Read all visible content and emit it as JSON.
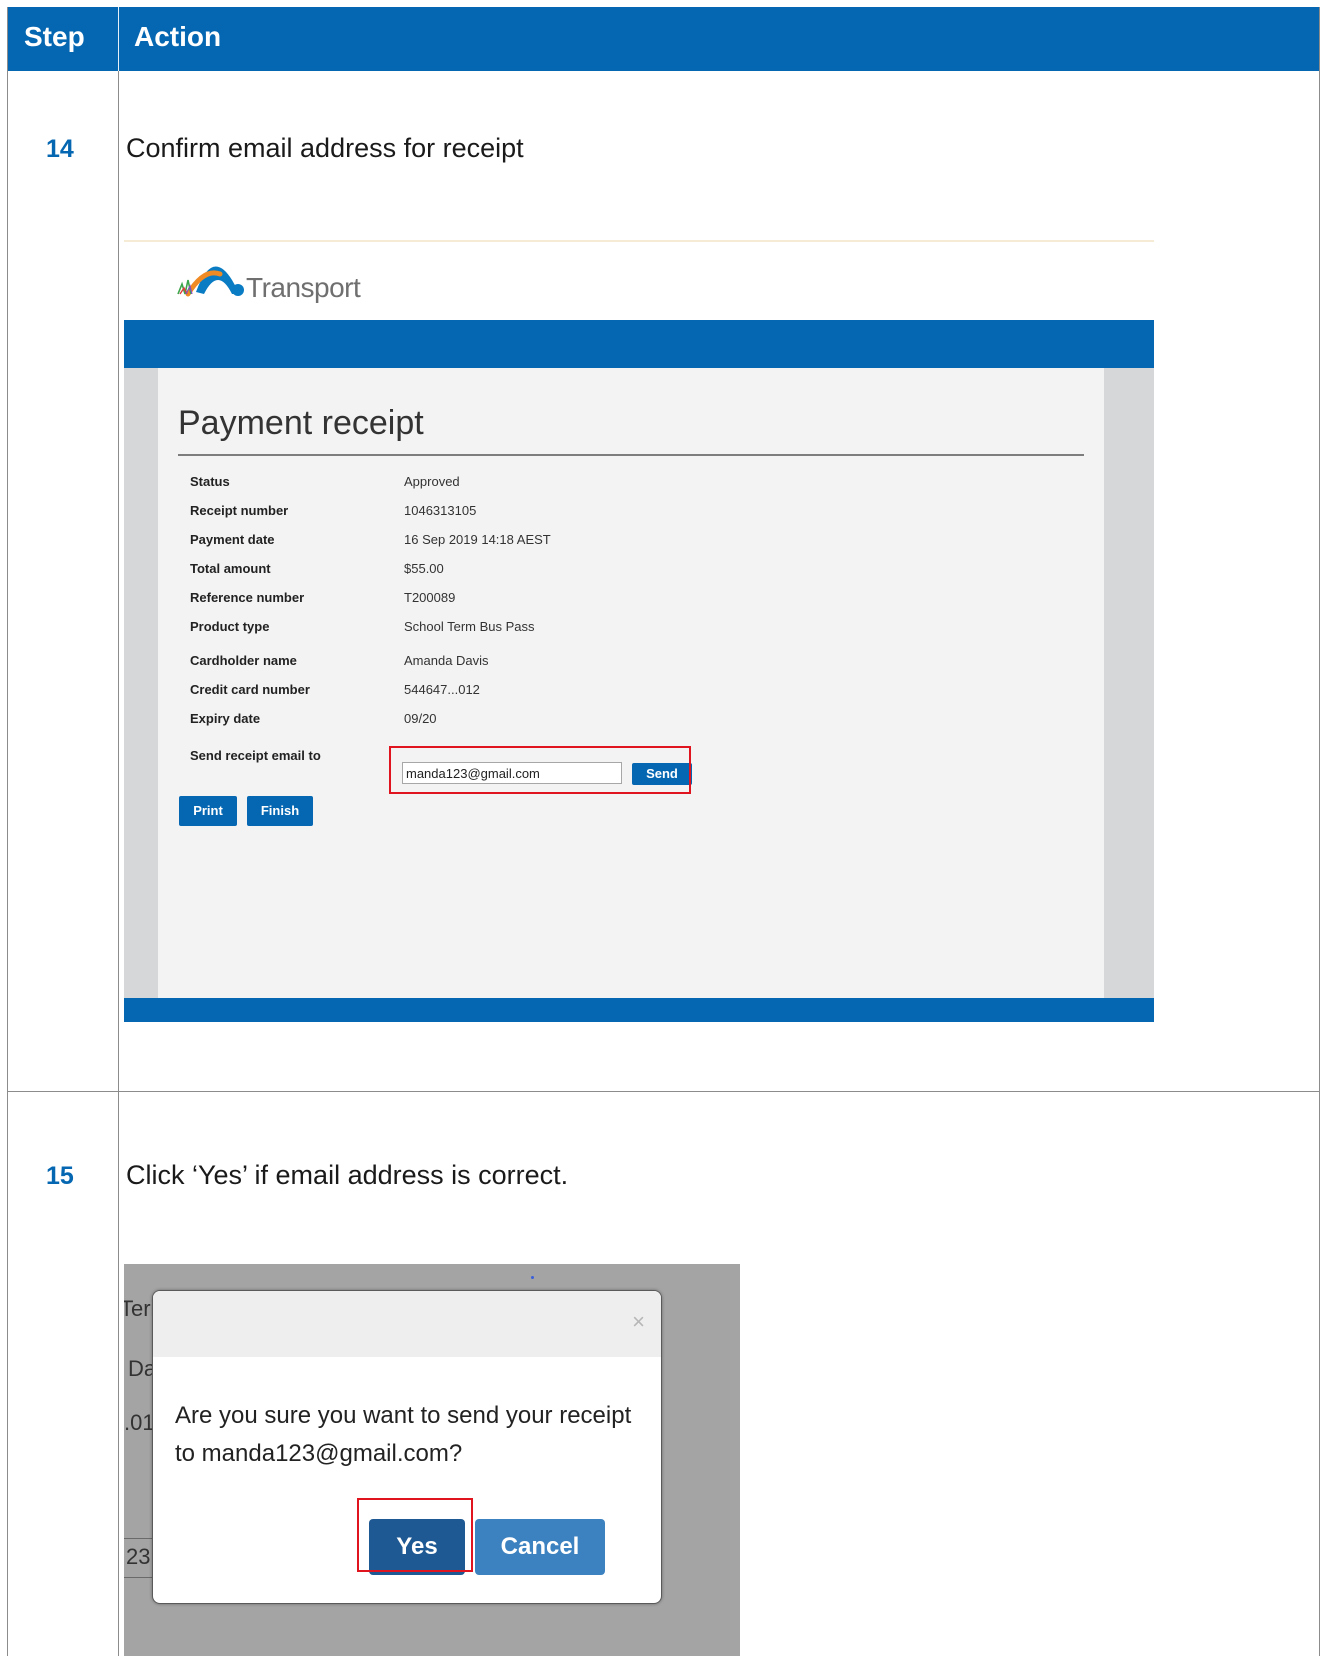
{
  "table": {
    "header": {
      "step": "Step",
      "action": "Action"
    },
    "rows": [
      {
        "step": "14",
        "action": "Confirm email address for receipt"
      },
      {
        "step": "15",
        "action": "Click ‘Yes’ if email address is correct."
      }
    ]
  },
  "receipt_screen": {
    "logo_text": "Transport",
    "title": "Payment receipt",
    "fields": [
      {
        "label": "Status",
        "value": "Approved"
      },
      {
        "label": "Receipt number",
        "value": "1046313105"
      },
      {
        "label": "Payment date",
        "value": "16 Sep 2019 14:18 AEST"
      },
      {
        "label": "Total amount",
        "value": "$55.00"
      },
      {
        "label": "Reference number",
        "value": "T200089"
      },
      {
        "label": "Product type",
        "value": "School Term Bus Pass"
      },
      {
        "label": "Cardholder name",
        "value": "Amanda Davis"
      },
      {
        "label": "Credit card number",
        "value": "544647...012"
      },
      {
        "label": "Expiry date",
        "value": "09/20"
      }
    ],
    "email_label": "Send receipt email to",
    "email_value": "manda123@gmail.com",
    "send_label": "Send",
    "print_label": "Print",
    "finish_label": "Finish"
  },
  "confirm_dialog": {
    "background_fragments": [
      "Teri",
      "Da",
      ".01",
      "23"
    ],
    "close_symbol": "×",
    "message": "Are you sure you want to send your receipt to manda123@gmail.com?",
    "yes_label": "Yes",
    "cancel_label": "Cancel"
  },
  "colors": {
    "brand_blue": "#0567b2",
    "highlight_red": "#e0141e"
  }
}
